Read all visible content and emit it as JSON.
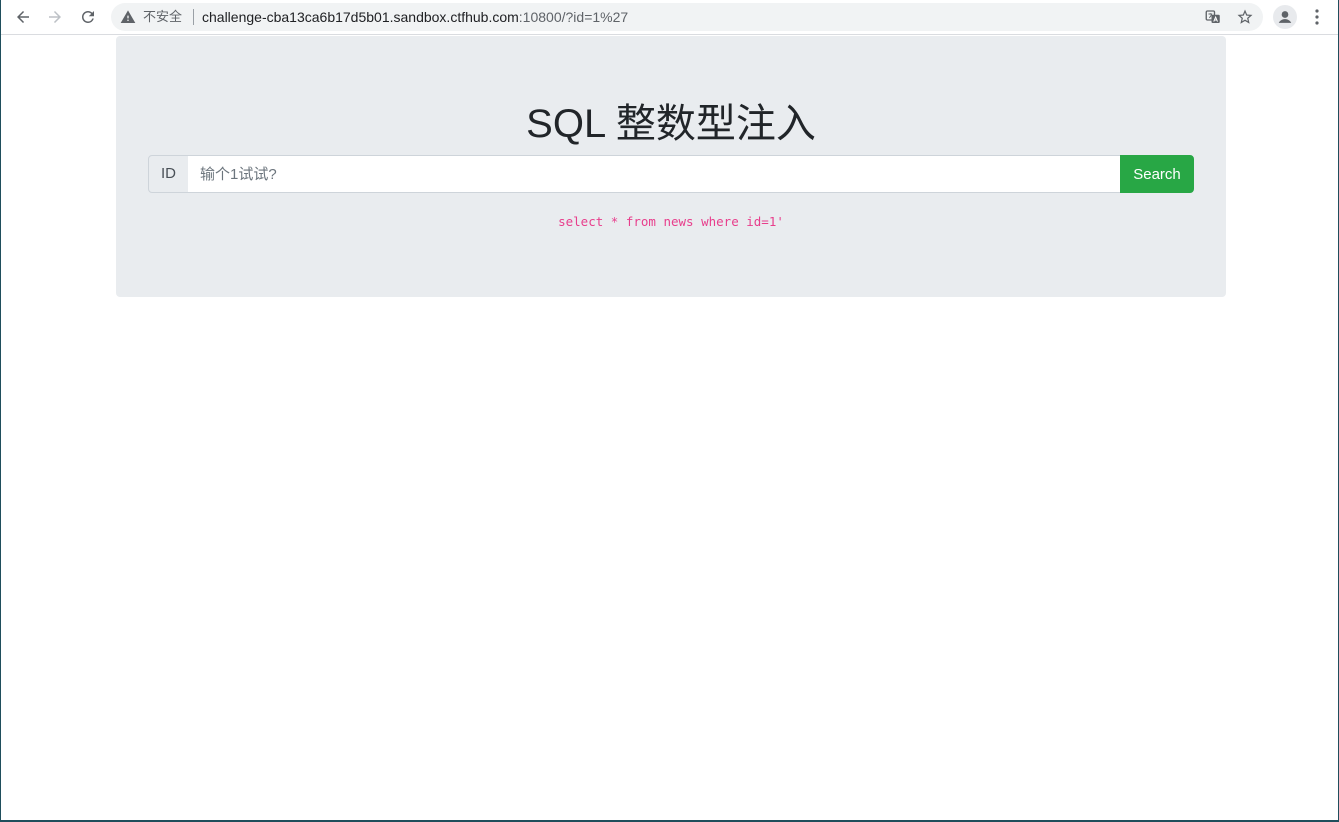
{
  "browser": {
    "security_label": "不安全",
    "url_host": "challenge-cba13ca6b17d5b01.sandbox.ctfhub.com",
    "url_rest": ":10800/?id=1%27",
    "icons": [
      "back-arrow-icon",
      "forward-arrow-icon",
      "reload-icon",
      "warning-icon",
      "translate-icon",
      "star-icon",
      "profile-icon",
      "more-vert-icon"
    ]
  },
  "page": {
    "title": "SQL 整数型注入",
    "input_prefix": "ID",
    "input_placeholder": "输个1试试?",
    "input_value": "",
    "search_label": "Search",
    "query_text": "select * from news where id=1'"
  },
  "colors": {
    "jumbotron_bg": "#e9ecef",
    "search_button": "#28a745",
    "query_text": "#e83e8c",
    "title_text": "#212529"
  }
}
